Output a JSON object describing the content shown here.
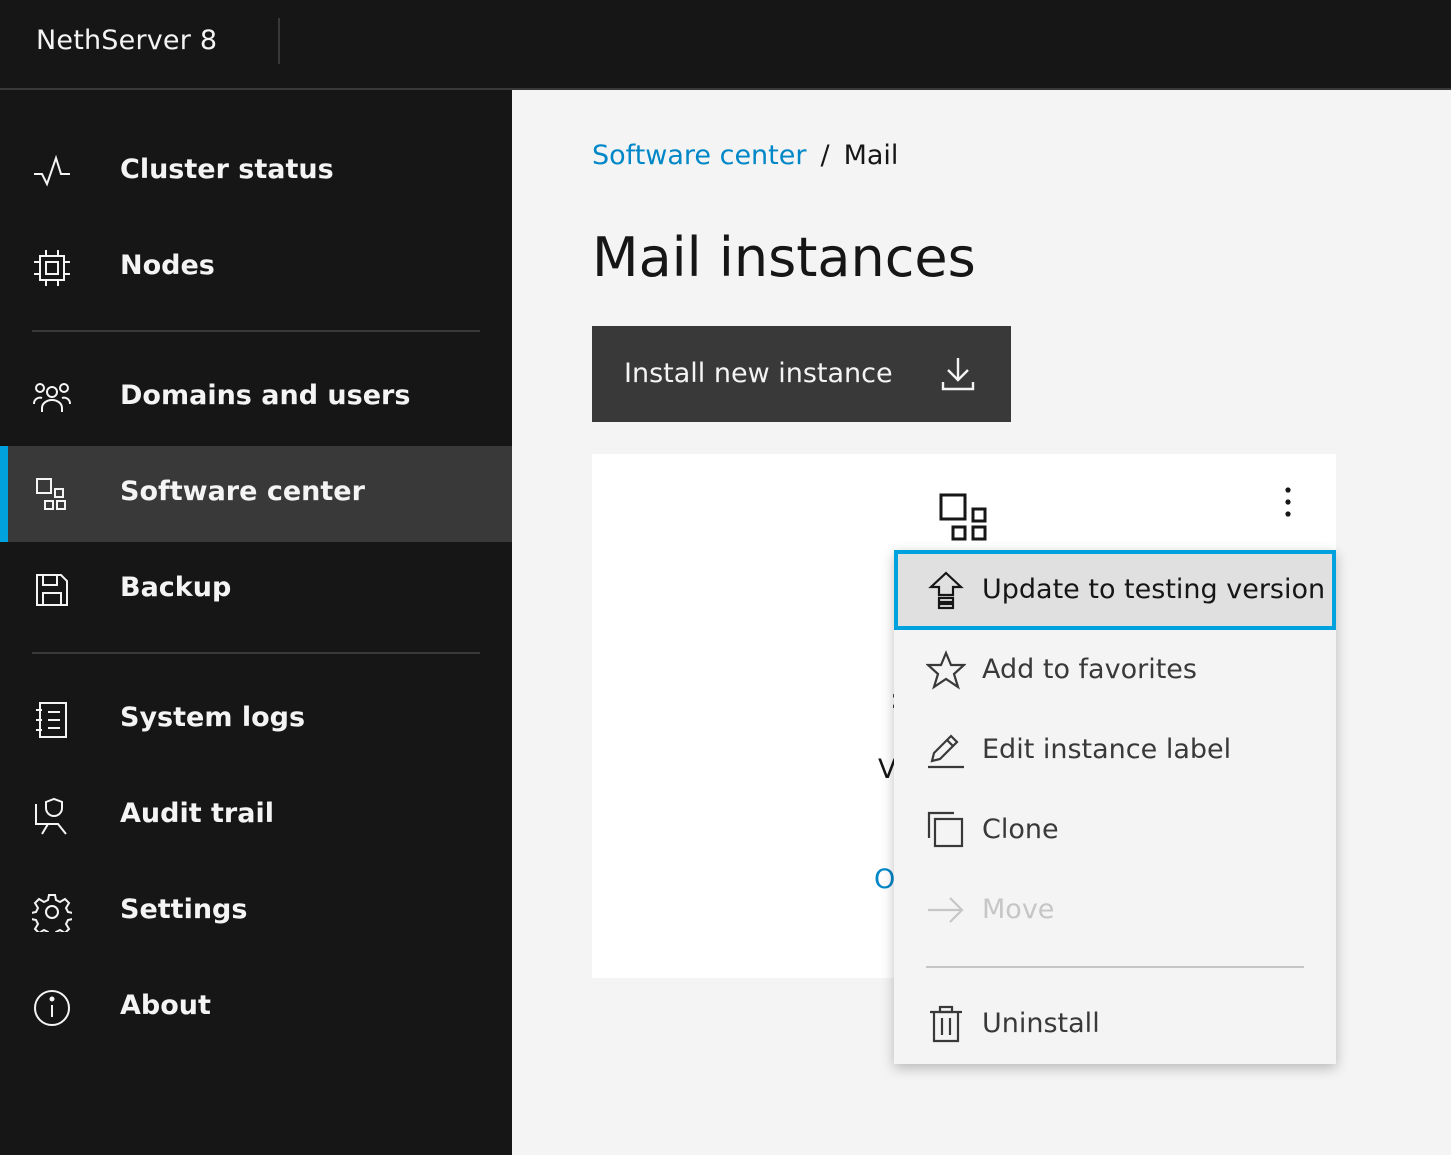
{
  "header": {
    "brand": "NethServer 8"
  },
  "sidenav": {
    "items": [
      {
        "label": "Cluster status",
        "icon": "activity-icon"
      },
      {
        "label": "Nodes",
        "icon": "chip-icon"
      },
      {
        "label": "Domains and users",
        "icon": "users-icon"
      },
      {
        "label": "Software center",
        "icon": "apps-icon",
        "active": true
      },
      {
        "label": "Backup",
        "icon": "save-icon"
      },
      {
        "label": "System logs",
        "icon": "logs-icon"
      },
      {
        "label": "Audit trail",
        "icon": "audit-icon"
      },
      {
        "label": "Settings",
        "icon": "gear-icon"
      },
      {
        "label": "About",
        "icon": "info-icon"
      }
    ]
  },
  "breadcrumb": {
    "parent": "Software center",
    "separator": "/",
    "current": "Mail"
  },
  "page": {
    "title": "Mail instances"
  },
  "install_button": {
    "label": "Install new instance"
  },
  "tile": {
    "partial_text_1": ":",
    "partial_text_2": "V",
    "partial_link": "O"
  },
  "overflow_menu": {
    "items": [
      {
        "label": "Update to testing version",
        "icon": "upload-icon",
        "state": "focused"
      },
      {
        "label": "Add to favorites",
        "icon": "star-icon",
        "state": "normal"
      },
      {
        "label": "Edit instance label",
        "icon": "edit-icon",
        "state": "normal"
      },
      {
        "label": "Clone",
        "icon": "copy-icon",
        "state": "normal"
      },
      {
        "label": "Move",
        "icon": "arrow-right-icon",
        "state": "disabled"
      },
      {
        "label": "Uninstall",
        "icon": "trash-icon",
        "state": "normal"
      }
    ]
  },
  "colors": {
    "accent": "#00a2de",
    "link": "#0087c7",
    "sidebar_bg": "#161616",
    "active_bg": "#393939",
    "content_bg": "#f4f4f4"
  }
}
